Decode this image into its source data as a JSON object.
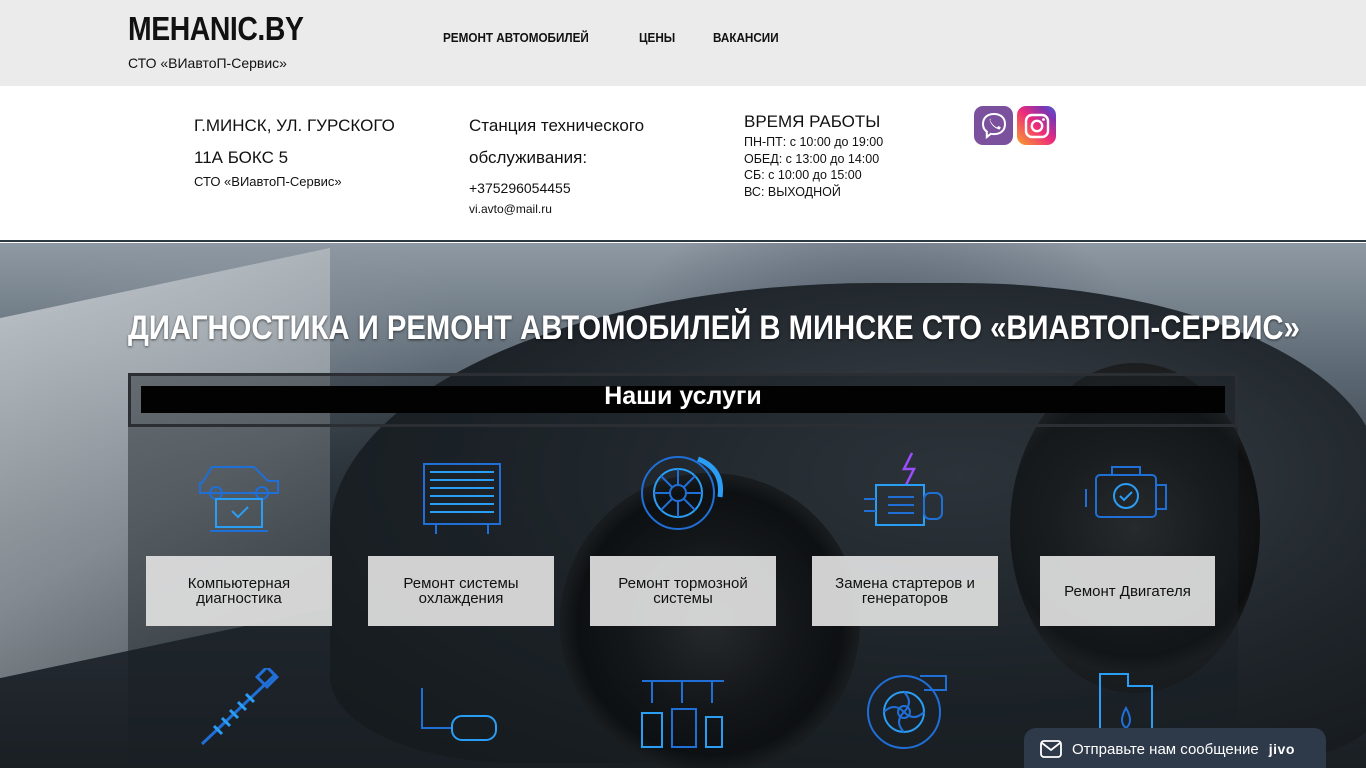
{
  "header": {
    "logo": "MEHANIC.BY",
    "subtitle": "СТО «ВИавтоП-Сервис»",
    "nav": [
      "РЕМОНТ АВТОМОБИЛЕЙ",
      "ЦЕНЫ",
      "ВАКАНСИИ"
    ]
  },
  "info": {
    "address_line1": "Г.МИНСК, УЛ. ГУРСКОГО",
    "address_line2": "11А БОКС 5",
    "address_company": "СТО «ВИавтоП-Сервис»",
    "station_line1": "Станция технического",
    "station_line2": "обслуживания:",
    "phone": "+375296054455",
    "email": "vi.avto@mail.ru",
    "hours_title": "ВРЕМЯ РАБОТЫ",
    "hours": [
      "ПН-ПТ: с 10:00 до 19:00",
      "ОБЕД: с 13:00 до 14:00",
      "СБ: с 10:00 до 15:00",
      "ВС: ВЫХОДНОЙ"
    ],
    "social_icons": [
      "viber-icon",
      "instagram-icon"
    ]
  },
  "hero": {
    "title": "ДИАГНОСТИКА И РЕМОНТ АВТОМОБИЛЕЙ В МИНСКЕ СТО «ВИАВТОП-СЕРВИС»",
    "services_title": "Наши услуги",
    "services": [
      {
        "label": "Компьютерная диагностика",
        "icon": "car-laptop-icon"
      },
      {
        "label": "Ремонт системы охлаждения",
        "icon": "radiator-icon"
      },
      {
        "label": "Ремонт тормозной системы",
        "icon": "brake-disc-icon"
      },
      {
        "label": "Замена стартеров и генераторов",
        "icon": "starter-icon"
      },
      {
        "label": "Ремонт Двигателя",
        "icon": "engine-icon"
      }
    ],
    "second_row_icons": [
      "shock-absorber-icon",
      "exhaust-icon",
      "pedals-icon",
      "turbo-icon",
      "oil-canister-icon"
    ]
  },
  "chat": {
    "text": "Отправьте нам сообщение",
    "brand": "jivo"
  },
  "colors": {
    "icon_blue": "#1f6fd6",
    "icon_accent": "#2a9df4",
    "header_bg": "#ebebeb",
    "chat_bg": "#2e3949",
    "viber": "#7b519d"
  }
}
